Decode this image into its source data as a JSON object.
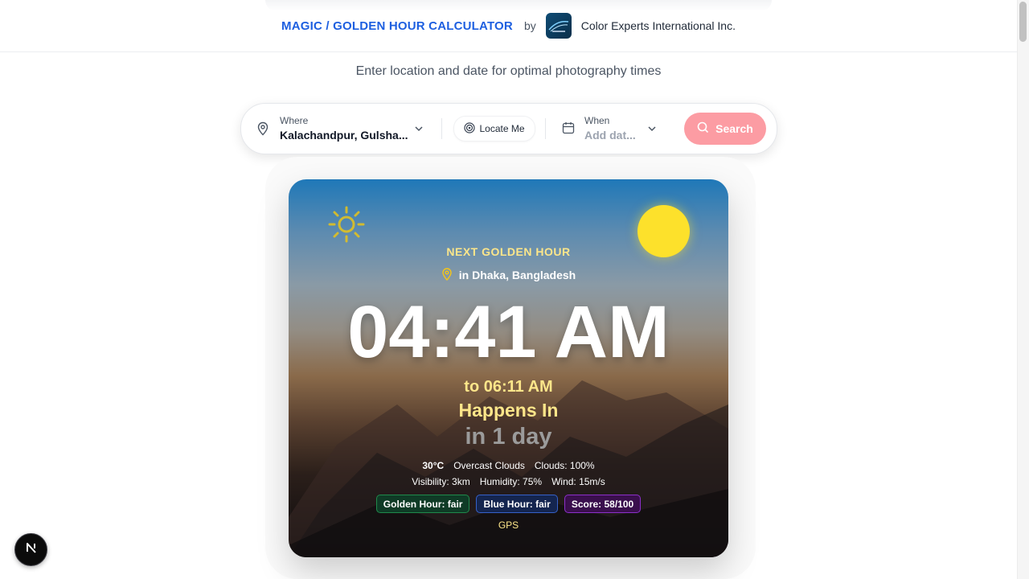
{
  "header": {
    "title": "MAGIC / GOLDEN HOUR CALCULATOR",
    "by": "by",
    "company": "Color Experts International Inc."
  },
  "subtitle": "Enter location and date for optimal photography times",
  "search": {
    "where_label": "Where",
    "where_value": "Kalachandpur, Gulsha...",
    "locate_label": "Locate Me",
    "when_label": "When",
    "when_placeholder": "Add dat...",
    "button_label": "Search"
  },
  "card": {
    "label": "NEXT GOLDEN HOUR",
    "location": "in Dhaka, Bangladesh",
    "time": "04:41 AM",
    "end_time": "to 06:11 AM",
    "happens": "Happens In",
    "countdown": "in 1 day",
    "temperature": "30°C",
    "condition": "Overcast Clouds",
    "clouds": "Clouds: 100%",
    "visibility": "Visibility: 3km",
    "humidity": "Humidity: 75%",
    "wind": "Wind: 15m/s",
    "badges": {
      "golden": "Golden Hour: fair",
      "blue": "Blue Hour: fair",
      "score": "Score: 58/100"
    },
    "source": "GPS"
  },
  "dev_badge": "N",
  "colors": {
    "accent": "#1d5fe0",
    "search_button": "#fc9ca3",
    "sun": "#fde12b",
    "highlight_text": "#fde68a"
  }
}
